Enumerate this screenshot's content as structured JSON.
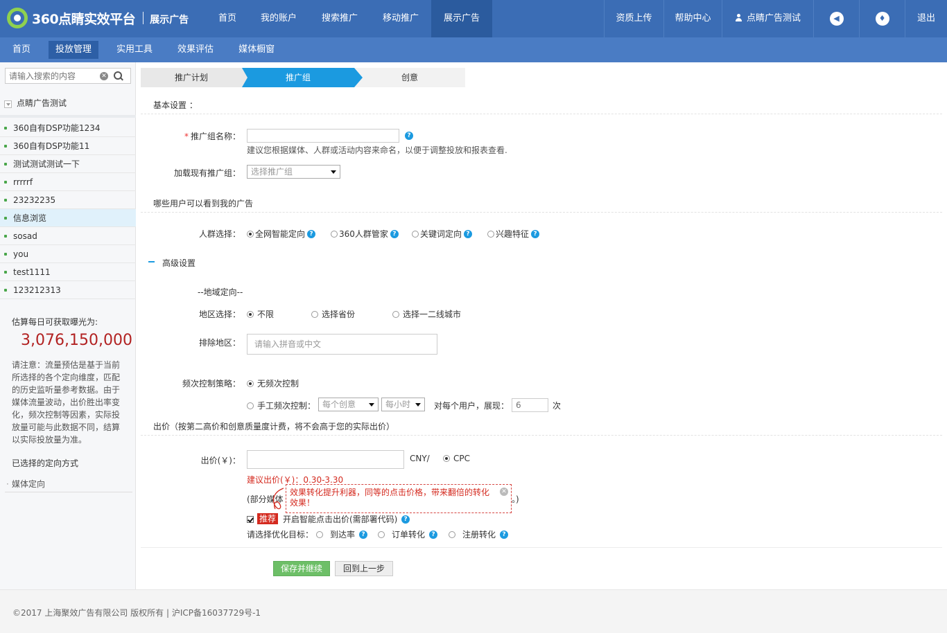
{
  "header": {
    "logo_text": "360点睛实效平台",
    "product": "展示广告",
    "nav": [
      {
        "label": "首页",
        "active": false
      },
      {
        "label": "我的账户",
        "active": false
      },
      {
        "label": "搜索推广",
        "active": false
      },
      {
        "label": "移动推广",
        "active": false
      },
      {
        "label": "展示广告",
        "active": true
      }
    ],
    "right": {
      "qualification": "资质上传",
      "help": "帮助中心",
      "user": "点睛广告测试",
      "logout": "退出"
    }
  },
  "subnav": [
    {
      "label": "首页",
      "active": false
    },
    {
      "label": "投放管理",
      "active": true
    },
    {
      "label": "实用工具",
      "active": false
    },
    {
      "label": "效果评估",
      "active": false
    },
    {
      "label": "媒体橱窗",
      "active": false
    }
  ],
  "sidebar": {
    "search_placeholder": "请输入搜索的内容",
    "account": "点睛广告测试",
    "groups": [
      {
        "label": "360自有DSP功能1234",
        "active": false
      },
      {
        "label": "360自有DSP功能11",
        "active": false
      },
      {
        "label": "测试测试测试一下",
        "active": false
      },
      {
        "label": "rrrrrf",
        "active": false
      },
      {
        "label": "23232235",
        "active": false
      },
      {
        "label": "信息浏览",
        "active": true
      },
      {
        "label": "sosad",
        "active": false
      },
      {
        "label": "you",
        "active": false
      },
      {
        "label": "test1111",
        "active": false
      },
      {
        "label": "123212313",
        "active": false
      }
    ],
    "estimate_title": "估算每日可获取曝光为:",
    "estimate_value": "3,076,150,000",
    "estimate_note": "请注意：流量预估是基于当前所选择的各个定向维度，匹配的历史监听量参考数据。由于媒体流量波动，出价胜出率变化，频次控制等因素，实际投放量可能与此数据不同，结算以实际投放量为准。",
    "selected_title": "已选择的定向方式",
    "selected_items": [
      "媒体定向"
    ]
  },
  "steps": [
    "推广计划",
    "推广组",
    "创意"
  ],
  "form": {
    "basic_title": "基本设置 ：",
    "group_name_label": "推广组名称：",
    "group_name_value": "",
    "group_name_hint": "建议您根据媒体、人群或活动内容来命名，以便于调整投放和报表查看.",
    "load_label": "加载现有推广组：",
    "load_select": "选择推广组",
    "audience_title": "哪些用户可以看到我的广告",
    "crowd_label": "人群选择：",
    "crowd_options": [
      {
        "label": "全网智能定向",
        "checked": true
      },
      {
        "label": "360人群管家",
        "checked": false
      },
      {
        "label": "关键词定向",
        "checked": false
      },
      {
        "label": "兴趣特征",
        "checked": false
      }
    ],
    "advanced_title": "高级设置",
    "geo_title": "--地域定向--",
    "region_label": "地区选择：",
    "region_options": [
      {
        "label": "不限",
        "checked": true
      },
      {
        "label": "选择省份",
        "checked": false
      },
      {
        "label": "选择一二线城市",
        "checked": false
      }
    ],
    "exclude_label": "排除地区：",
    "exclude_placeholder": "请输入拼音或中文",
    "freq_label": "频次控制策略：",
    "freq_option_none": "无频次控制",
    "freq_option_manual": "手工频次控制：",
    "freq_select_1": "每个创意",
    "freq_select_2": "每小时",
    "freq_per_user": "对每个用户，展现：",
    "freq_count_placeholder": "6",
    "freq_unit": "次",
    "bid_title": "出价（按第二高价和创意质量度计费，将不会高于您的实际出价）",
    "bid_label": "出价(￥)：",
    "bid_value": "",
    "bid_unit": "CNY/",
    "bid_mode": "CPC",
    "bid_suggest": "建议出价(￥)：0.30-3.30",
    "bid_note_start": "(部分媒体",
    "bid_note_end": "。)",
    "tooltip": "效果转化提升利器，同等的点击价格，带来翻倍的转化效果！",
    "recommend_badge": "推荐",
    "smart_bid": "开启智能点击出价(需部署代码)",
    "optimize_label": "请选择优化目标：",
    "optimize_options": [
      "到达率",
      "订单转化",
      "注册转化"
    ],
    "save_button": "保存并继续",
    "back_button": "回到上一步"
  },
  "footer": {
    "copyright": "©2017 上海聚效广告有限公司 版权所有 | 沪ICP备16037729号-1"
  },
  "colors": {
    "header_bg": "#3b6db5",
    "subnav_bg": "#4a7cc4",
    "accent": "#1b9ae0",
    "estimate": "#b22222",
    "warning": "#d42a1f",
    "save": "#6dbf67"
  }
}
